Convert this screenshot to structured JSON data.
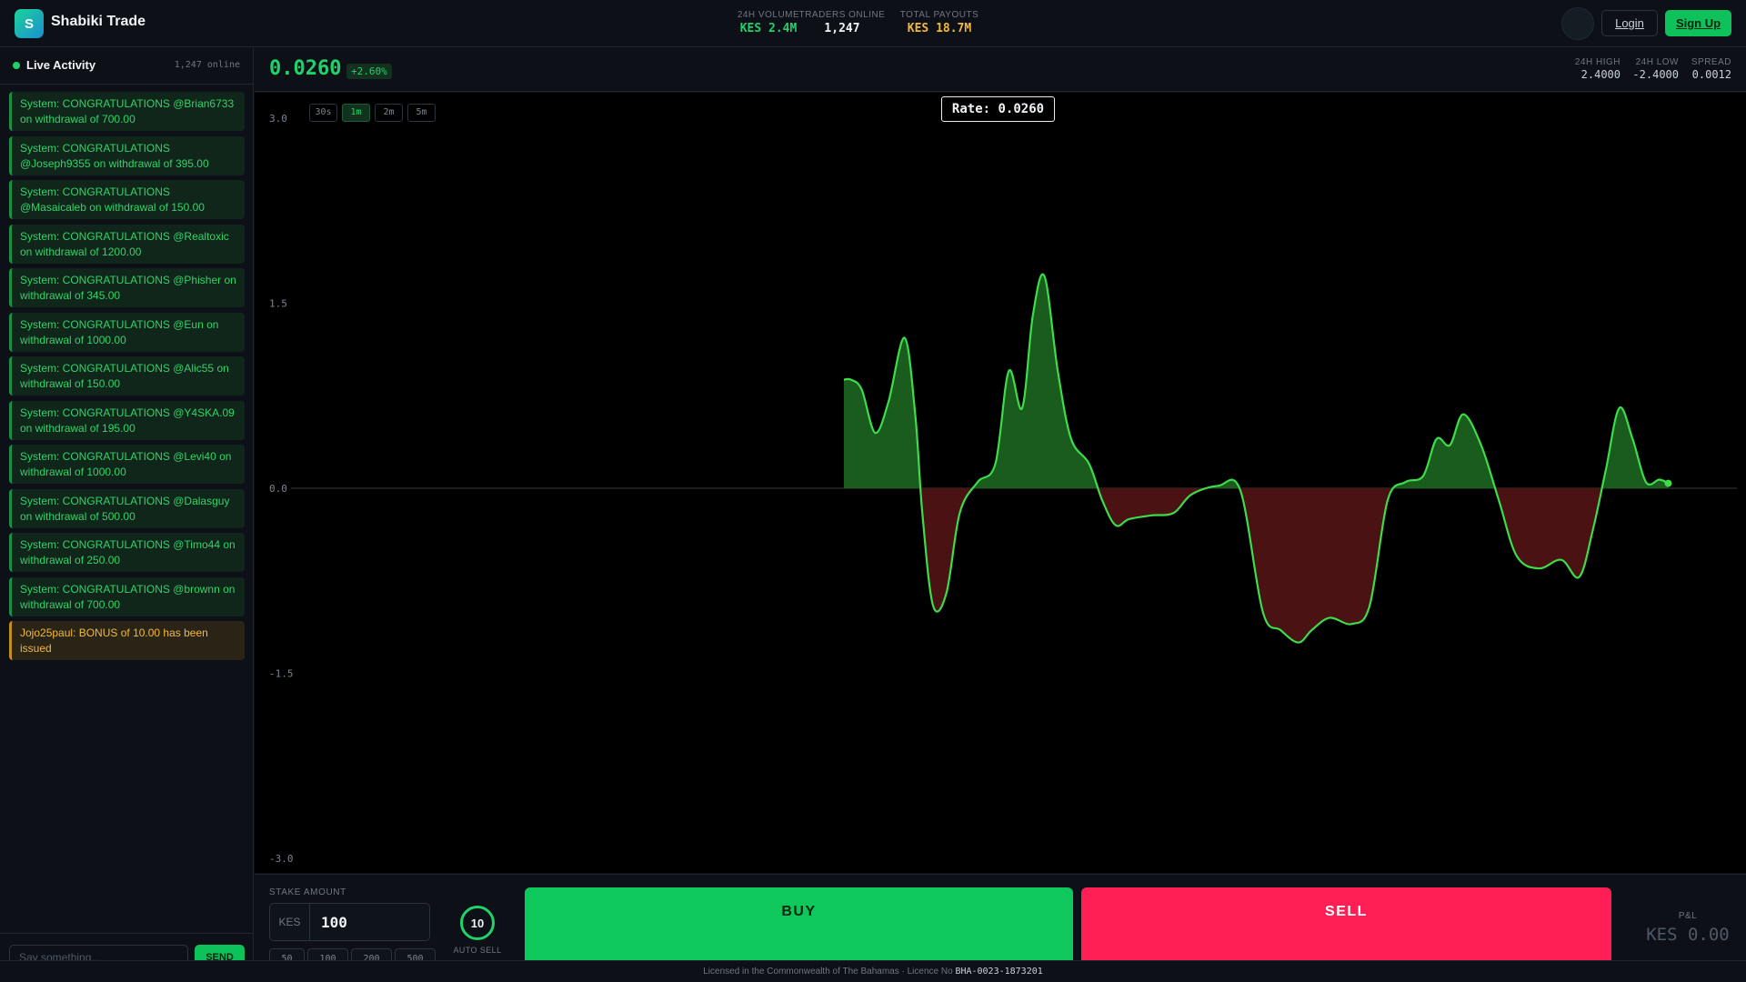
{
  "brand": {
    "logo_letter": "S",
    "name": "Shabiki Trade"
  },
  "header": {
    "stats": [
      {
        "label": "24H VOLUME",
        "value": "KES 2.4M",
        "color": "#1fd26b"
      },
      {
        "label": "TRADERS ONLINE",
        "value": "1,247",
        "color": "#f0f3f6"
      },
      {
        "label": "TOTAL PAYOUTS",
        "value": "KES 18.7M",
        "color": "#f2b93b"
      }
    ],
    "login_label": "Login",
    "signup_label": "Sign Up"
  },
  "sidebar": {
    "title": "Live Activity",
    "online": "1,247 online",
    "messages": [
      {
        "text": "System: CONGRATULATIONS @Brian6733 on withdrawal of 700.00",
        "type": "system"
      },
      {
        "text": "System: CONGRATULATIONS @Joseph9355 on withdrawal of 395.00",
        "type": "system"
      },
      {
        "text": "System: CONGRATULATIONS @Masaicaleb on withdrawal of 150.00",
        "type": "system"
      },
      {
        "text": "System: CONGRATULATIONS @Realtoxic on withdrawal of 1200.00",
        "type": "system"
      },
      {
        "text": "System: CONGRATULATIONS @Phisher on withdrawal of 345.00",
        "type": "system"
      },
      {
        "text": "System: CONGRATULATIONS @Eun on withdrawal of 1000.00",
        "type": "system"
      },
      {
        "text": "System: CONGRATULATIONS @Alic55 on withdrawal of 150.00",
        "type": "system"
      },
      {
        "text": "System: CONGRATULATIONS @Y4SKA.09 on withdrawal of 195.00",
        "type": "system"
      },
      {
        "text": "System: CONGRATULATIONS @Levi40 on withdrawal of 1000.00",
        "type": "system"
      },
      {
        "text": "System: CONGRATULATIONS @Dalasguy on withdrawal of 500.00",
        "type": "system"
      },
      {
        "text": "System: CONGRATULATIONS @Timo44 on withdrawal of 250.00",
        "type": "system"
      },
      {
        "text": "System: CONGRATULATIONS @brownn on withdrawal of 700.00",
        "type": "system"
      },
      {
        "text": "Jojo25paul: BONUS of 10.00 has been issued",
        "type": "bonus"
      }
    ],
    "chat_placeholder": "Say something...",
    "send_label": "SEND"
  },
  "ticker": {
    "price": "0.0260",
    "change": "+2.60%",
    "stats": [
      {
        "label": "24H HIGH",
        "value": "2.4000"
      },
      {
        "label": "24H LOW",
        "value": "-2.4000"
      },
      {
        "label": "SPREAD",
        "value": "0.0012"
      }
    ]
  },
  "timeframes": [
    {
      "label": "30s",
      "active": false
    },
    {
      "label": "1m",
      "active": true
    },
    {
      "label": "2m",
      "active": false
    },
    {
      "label": "5m",
      "active": false
    }
  ],
  "rate_label": "Rate: 0.0260",
  "chart_data": {
    "type": "area",
    "ylim": [
      -3.0,
      3.0
    ],
    "y_ticks": [
      "3.0",
      "1.5",
      "0.0",
      "-1.5",
      "-3.0"
    ],
    "grid": false,
    "colors": {
      "line": "#3ddc4a",
      "positive_fill": "#1a5c1d",
      "negative_fill": "#4a1212",
      "zero_line": "#3a3a3a"
    },
    "points": [
      [
        0.0,
        0.88
      ],
      [
        0.008,
        0.88
      ],
      [
        0.02,
        0.8
      ],
      [
        0.035,
        0.45
      ],
      [
        0.05,
        0.7
      ],
      [
        0.068,
        1.22
      ],
      [
        0.08,
        0.6
      ],
      [
        0.088,
        -0.2
      ],
      [
        0.1,
        -0.95
      ],
      [
        0.115,
        -0.85
      ],
      [
        0.13,
        -0.2
      ],
      [
        0.15,
        0.05
      ],
      [
        0.17,
        0.2
      ],
      [
        0.185,
        0.95
      ],
      [
        0.2,
        0.65
      ],
      [
        0.212,
        1.4
      ],
      [
        0.225,
        1.72
      ],
      [
        0.24,
        0.95
      ],
      [
        0.255,
        0.4
      ],
      [
        0.275,
        0.2
      ],
      [
        0.29,
        -0.1
      ],
      [
        0.305,
        -0.3
      ],
      [
        0.32,
        -0.25
      ],
      [
        0.345,
        -0.22
      ],
      [
        0.37,
        -0.2
      ],
      [
        0.39,
        -0.05
      ],
      [
        0.42,
        0.02
      ],
      [
        0.445,
        -0.02
      ],
      [
        0.47,
        -1.0
      ],
      [
        0.49,
        -1.15
      ],
      [
        0.51,
        -1.25
      ],
      [
        0.525,
        -1.15
      ],
      [
        0.545,
        -1.05
      ],
      [
        0.57,
        -1.1
      ],
      [
        0.59,
        -0.95
      ],
      [
        0.61,
        -0.1
      ],
      [
        0.63,
        0.05
      ],
      [
        0.65,
        0.1
      ],
      [
        0.665,
        0.4
      ],
      [
        0.68,
        0.35
      ],
      [
        0.695,
        0.6
      ],
      [
        0.715,
        0.35
      ],
      [
        0.735,
        -0.1
      ],
      [
        0.755,
        -0.55
      ],
      [
        0.78,
        -0.65
      ],
      [
        0.805,
        -0.58
      ],
      [
        0.825,
        -0.72
      ],
      [
        0.84,
        -0.35
      ],
      [
        0.855,
        0.15
      ],
      [
        0.87,
        0.65
      ],
      [
        0.885,
        0.4
      ],
      [
        0.9,
        0.05
      ],
      [
        0.915,
        0.07
      ],
      [
        0.925,
        0.04
      ]
    ]
  },
  "trade": {
    "stake_label": "STAKE AMOUNT",
    "currency": "KES",
    "stake_value": "100",
    "chips": [
      "50",
      "100",
      "200",
      "500"
    ],
    "autosell_value": "10",
    "autosell_label": "AUTO SELL",
    "buy_label": "BUY",
    "sell_label": "SELL",
    "pnl_label": "P&L",
    "pnl_value": "KES 0.00"
  },
  "footer": {
    "text": "Licensed in the Commonwealth of The Bahamas · Licence No",
    "licence": "BHA-0023-1873201"
  }
}
